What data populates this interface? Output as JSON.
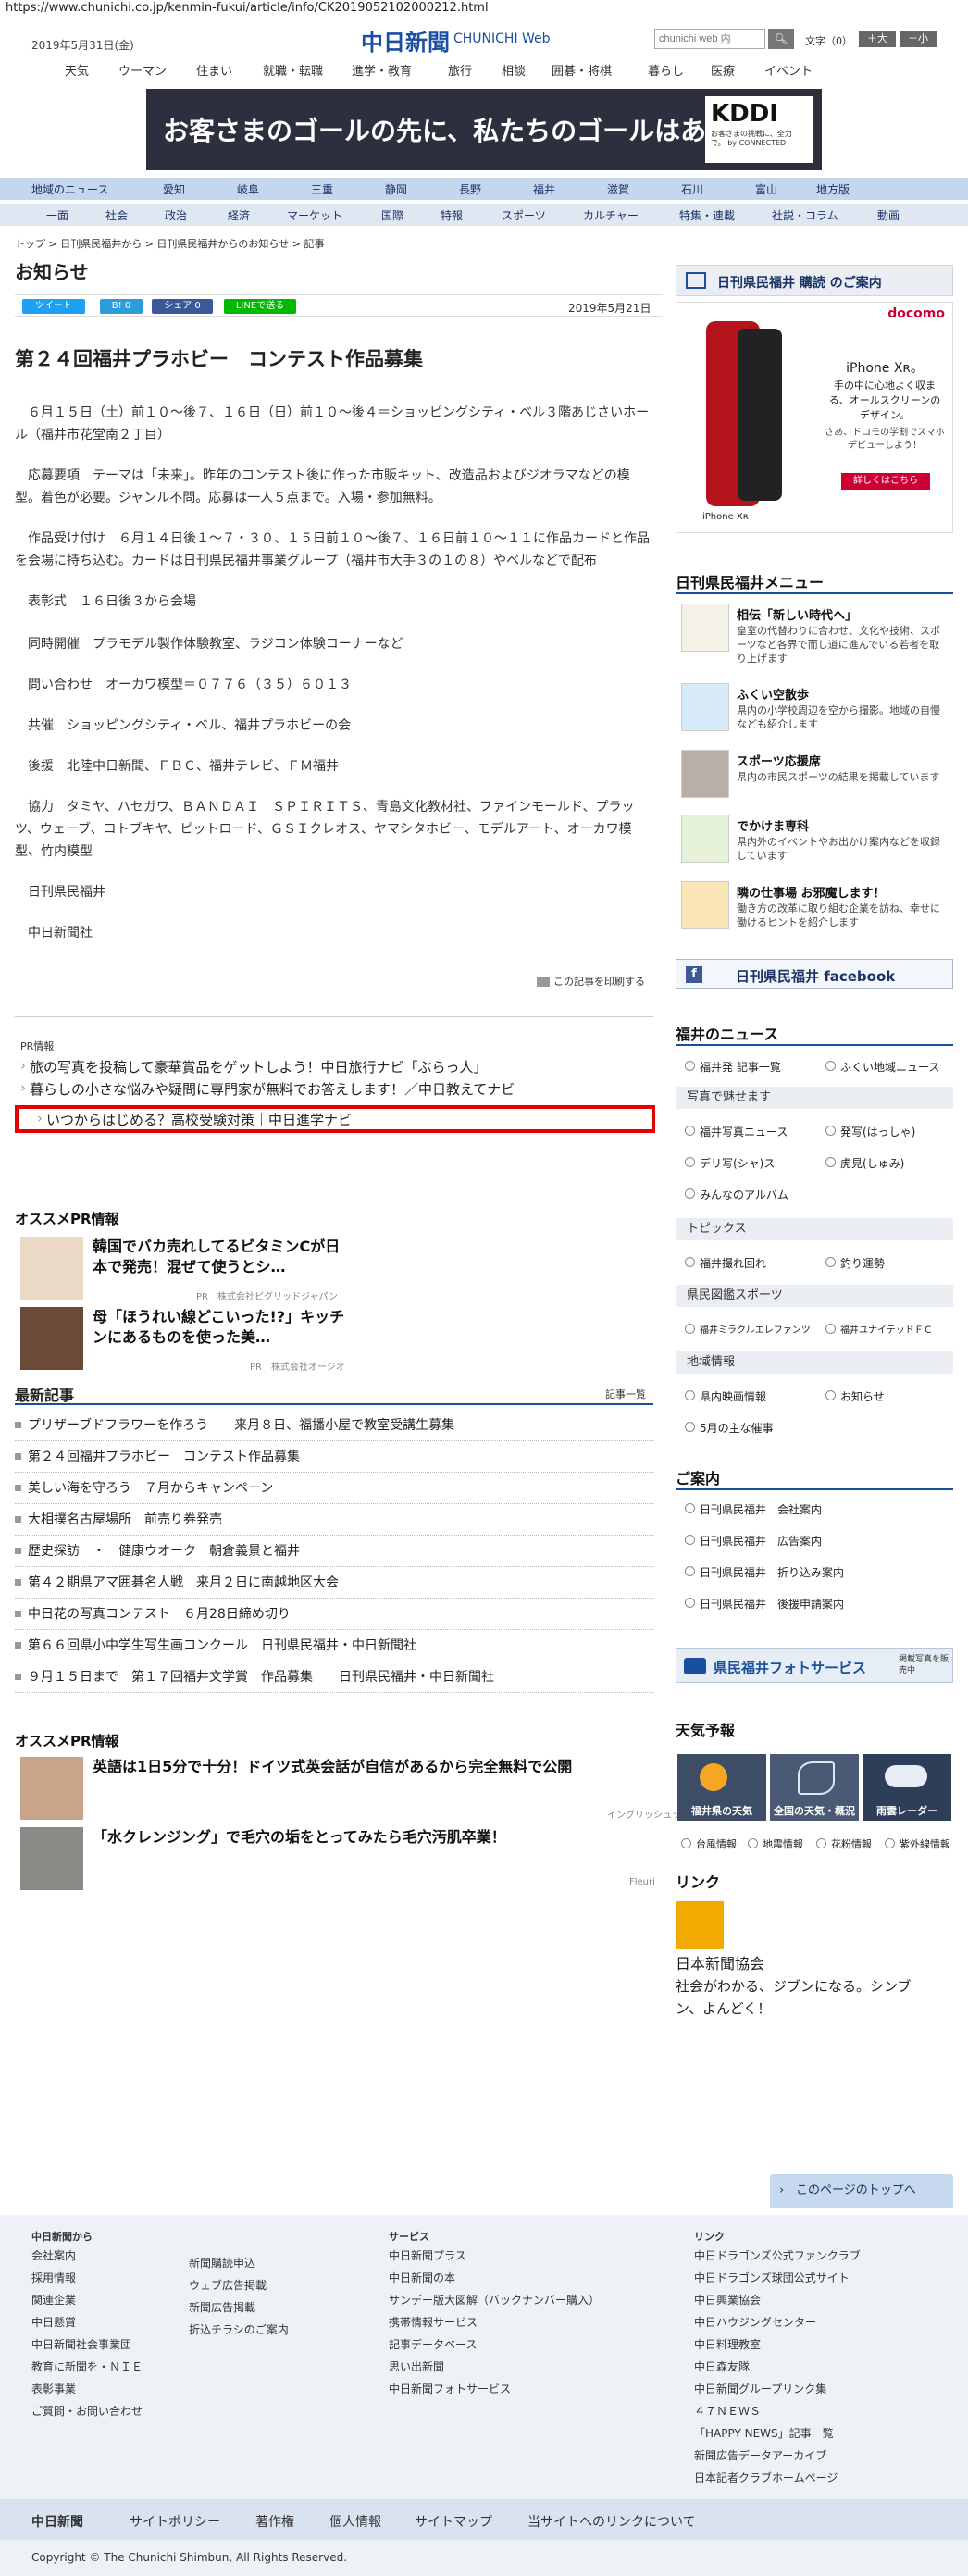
{
  "browser": {
    "url": "https://www.chunichi.co.jp/kenmin-fukui/article/info/CK2019052102000212.html"
  },
  "header": {
    "date": "2019年5月31日(金)",
    "logo": "中日新聞",
    "logo_sub": "CHUNICHI Web",
    "search_placeholder": "chunichi web 内",
    "font_size_label": "文字（0）",
    "font_up": "＋大",
    "font_down": "－小"
  },
  "topnav": [
    "天気",
    "ウーマン",
    "住まい",
    "就職・転職",
    "進学・教育",
    "旅行",
    "相談",
    "囲碁・将棋",
    "暮らし",
    "医療",
    "イベント"
  ],
  "banner": {
    "text": "お客さまのゴールの先に、私たちのゴールはある。",
    "brand": "KDDI",
    "tagline": "お客さまの挑戦に、全力で。 by CONNECTED"
  },
  "regions": [
    "地域のニュース",
    "愛知",
    "岐阜",
    "三重",
    "静岡",
    "長野",
    "福井",
    "滋賀",
    "石川",
    "富山",
    "地方版"
  ],
  "categories": [
    "一面",
    "社会",
    "政治",
    "経済",
    "マーケット",
    "国際",
    "特報",
    "スポーツ",
    "カルチャー",
    "特集・連載",
    "社説・コラム",
    "動画"
  ],
  "breadcrumb": "トップ > 日刊県民福井から > 日刊県民福井からのお知らせ > 記事",
  "page_heading": "お知らせ",
  "share": {
    "tweet": "ツイート",
    "hatena": "B! 0",
    "facebook": "シェア 0",
    "line": "LINEで送る"
  },
  "article": {
    "date": "2019年5月21日",
    "title": "第２４回福井プラホビー　コンテスト作品募集",
    "paragraphs": [
      "　６月１５日（土）前１０～後７、１６日（日）前１０～後４＝ショッピングシティ・ベル３階あじさいホール（福井市花堂南２丁目）",
      "　応募要項　テーマは「未来」。昨年のコンテスト後に作った市販キット、改造品およびジオラマなどの模型。着色が必要。ジャンル不問。応募は一人５点まで。入場・参加無料。",
      "　作品受け付け　６月１４日後１～７・３０、１５日前１０～後７、１６日前１０～１１に作品カードと作品を会場に持ち込む。カードは日刊県民福井事業グループ（福井市大手３の１の８）やベルなどで配布",
      "　表彰式　１６日後３から会場",
      "　同時開催　プラモデル製作体験教室、ラジコン体験コーナーなど",
      "　問い合わせ　オーカワ模型＝０７７６（３５）６０１３",
      "　共催　ショッピングシティ・ベル、福井プラホビーの会",
      "　後援　北陸中日新聞、ＦＢＣ、福井テレビ、ＦＭ福井",
      "　協力　タミヤ、ハセガワ、ＢＡＮＤＡＩ　ＳＰＩＲＩＴＳ、青島文化教材社、ファインモールド、プラッツ、ウェーブ、コトブキヤ、ピットロード、ＧＳＩクレオス、ヤマシタホビー、モデルアート、オーカワ模型、竹内模型",
      "　日刊県民福井",
      "　中日新聞社"
    ],
    "print": "この記事を印刷する"
  },
  "pr": {
    "label": "PR情報",
    "links": [
      "旅の写真を投稿して豪華賞品をゲットしよう！中日旅行ナビ「ぶらっ人」",
      "暮らしの小さな悩みや疑問に専門家が無料でお答えします！／中日教えてナビ",
      "いつからはじめる？高校受験対策｜中日進学ナビ"
    ]
  },
  "reco1": {
    "heading": "オススメPR情報",
    "items": [
      {
        "title": "韓国でバカ売れしてるビタミンCが日本で発売！混ぜて使うとシ…",
        "source": "PR　株式会社ピグリッドジャパン"
      },
      {
        "title": "母「ほうれい線どこいった!?」キッチンにあるものを使った美…",
        "source": "PR　株式会社オージオ"
      }
    ]
  },
  "latest": {
    "heading": "最新記事",
    "more": "記事一覧",
    "items": [
      "プリザーブドフラワーを作ろう　　来月８日、福播小屋で教室受講生募集",
      "第２４回福井プラホビー　コンテスト作品募集",
      "美しい海を守ろう　７月からキャンペーン",
      "大相撲名古屋場所　前売り券発売",
      "歴史探訪　・　健康ウオーク　朝倉義景と福井",
      "第４２期県アマ囲碁名人戦　来月２日に南越地区大会",
      "中日花の写真コンテスト　６月28日締め切り",
      "第６６回県小中学生写生画コンクール　日刊県民福井・中日新聞社",
      "９月１５日まで　第１７回福井文学賞　作品募集　　日刊県民福井・中日新聞社"
    ]
  },
  "reco2": {
    "heading": "オススメPR情報",
    "items": [
      {
        "title": "英語は1日5分で十分！ドイツ式英会話が自信があるから完全無料で公開",
        "source": "イングリッシュライフ"
      },
      {
        "title": "「水クレンジング」で毛穴の垢をとってみたら毛穴汚肌卒業！",
        "source": "Fleuri"
      }
    ]
  },
  "sidebar": {
    "subscribe": "日刊県民福井 購読 のご案内",
    "ad": {
      "brand": "docomo",
      "model": "iPhone Xʀ。",
      "copy": "手の中に心地よく収まる、オールスクリーンのデザイン。",
      "sub": "さあ、ドコモの学割でスマホデビューしよう！",
      "button": "詳しくはこちら",
      "label": "iPhone Xʀ"
    },
    "menu_title": "日刊県民福井メニュー",
    "menu": [
      {
        "title": "相伝「新しい時代へ」",
        "desc": "皇室の代替わりに合わせ、文化や技術、スポーツなど各界で而し道に進んでいる若者を取り上げます"
      },
      {
        "title": "ふくい空散歩",
        "desc": "県内の小学校周辺を空から撮影。地域の自慢なども紹介します"
      },
      {
        "title": "スポーツ応援席",
        "desc": "県内の市民スポーツの結果を掲載しています"
      },
      {
        "title": "でかけま専科",
        "desc": "県内外のイベントやお出かけ案内などを収録しています"
      },
      {
        "title": "隣の仕事場 お邪魔します！",
        "desc": "働き方の改革に取り組む企業を訪ね、幸せに働けるヒントを紹介します"
      }
    ],
    "facebook": "日刊県民福井 facebook",
    "news_title": "福井のニュース",
    "news_links": [
      "福井発 記事一覧",
      "ふくい地域ニュース"
    ],
    "photo_h": "写真で魅せます",
    "photo_links": [
      "福井写真ニュース",
      "発写(はっしゃ)",
      "デリ写(シャ)ス",
      "虎見(しゅみ)",
      "みんなのアルバム"
    ],
    "topics_h": "トピックス",
    "topics_links": [
      "福井撮れ回れ",
      "釣り運勢"
    ],
    "sports_h": "県民図鑑スポーツ",
    "sports_links": [
      "福井ミラクルエレファンツ",
      "福井ユナイテッドＦＣ"
    ],
    "local_h": "地域情報",
    "local_links": [
      "県内映画情報",
      "お知らせ",
      "5月の主な催事"
    ],
    "guide_title": "ご案内",
    "guide_links": [
      "日刊県民福井　会社案内",
      "日刊県民福井　広告案内",
      "日刊県民福井　折り込み案内",
      "日刊県民福井　後援申請案内"
    ],
    "photo_service": "県民福井フォトサービス",
    "photo_service_note": "掲載写真を販売中",
    "weather_title": "天気予報",
    "weather_tiles": [
      "福井県の天気",
      "全国の天気・概況",
      "雨雲レーダー"
    ],
    "weather_links": [
      "台風情報",
      "地震情報",
      "花粉情報",
      "紫外線情報"
    ],
    "link_title": "リンク",
    "link_name": "日本新聞協会",
    "link_desc": "社会がわかる、ジブンになる。シンブン、よんどく！"
  },
  "footer": {
    "to_top": "このページのトップへ",
    "col1_h": "中日新聞から",
    "col1a": [
      "会社案内",
      "採用情報",
      "関連企業",
      "中日懸賞",
      "中日新聞社会事業団",
      "教育に新聞を・ＮＩＥ",
      "表彰事業",
      "ご質問・お問い合わせ"
    ],
    "col1b": [
      "新聞購読申込",
      "ウェブ広告掲載",
      "新聞広告掲載",
      "折込チラシのご案内"
    ],
    "col2_h": "サービス",
    "col2": [
      "中日新聞プラス",
      "中日新聞の本",
      "サンデー版大図解（バックナンバー購入）",
      "携帯情報サービス",
      "記事データベース",
      "思い出新聞",
      "中日新聞フォトサービス"
    ],
    "col3_h": "リンク",
    "col3": [
      "中日ドラゴンズ公式ファンクラブ",
      "中日ドラゴンズ球団公式サイト",
      "中日興業協会",
      "中日ハウジングセンター",
      "中日料理教室",
      "中日森友隊",
      "中日新聞グループリンク集",
      "４７ＮＥＷＳ",
      "「HAPPY NEWS」記事一覧",
      "新聞広告データアーカイブ",
      "日本記者クラブホームページ"
    ],
    "bar": [
      "中日新聞",
      "サイトポリシー",
      "著作権",
      "個人情報",
      "サイトマップ",
      "当サイトへのリンクについて"
    ],
    "copyright": "Copyright © The Chunichi Shimbun, All Rights Reserved."
  },
  "colors": {
    "brand_blue": "#1a4fa0",
    "highlight_red": "#e60000",
    "nav_blue": "#c5d7ec"
  }
}
